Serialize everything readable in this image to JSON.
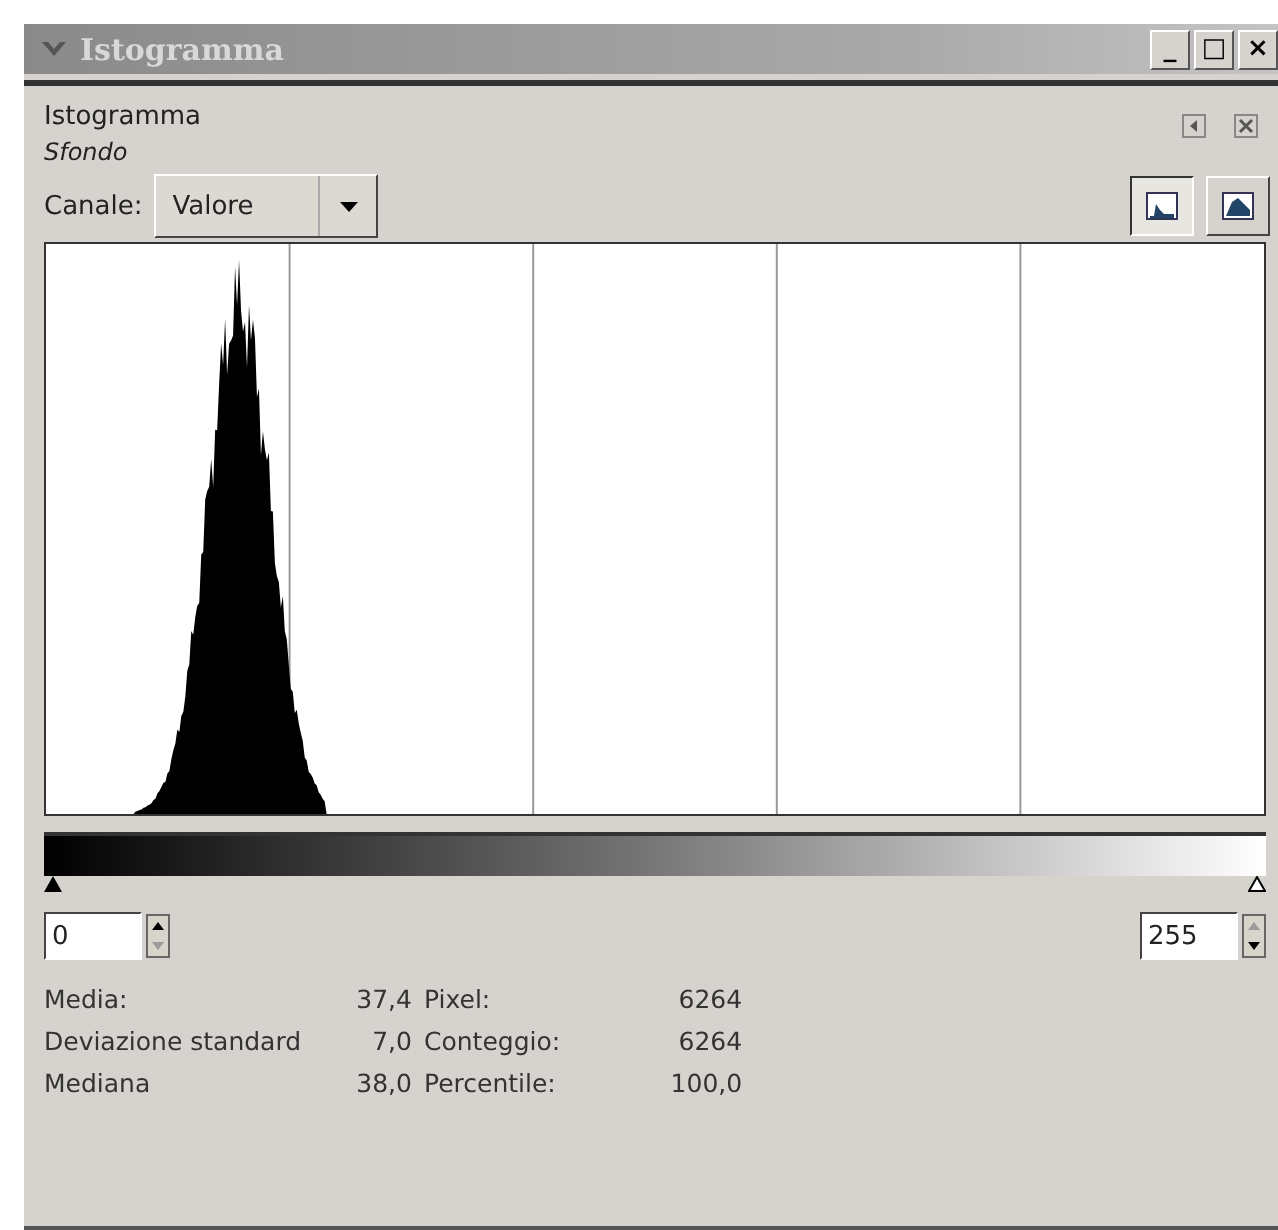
{
  "window": {
    "title": "Istogramma",
    "controls": [
      "_",
      "□",
      "×"
    ]
  },
  "panel": {
    "title": "Istogramma",
    "subtitle": "Sfondo"
  },
  "channel": {
    "label": "Canale:",
    "value": "Valore"
  },
  "scale_buttons": [
    {
      "kind": "linear",
      "selected": true
    },
    {
      "kind": "log",
      "selected": false
    }
  ],
  "range": {
    "min": "0",
    "max": "255"
  },
  "stats": [
    {
      "label": "Media:",
      "value": "37,4",
      "label2": "Pixel:",
      "value2": "6264"
    },
    {
      "label": "Deviazione standard",
      "value": "7,0",
      "label2": "Conteggio:",
      "value2": "6264"
    },
    {
      "label": "Mediana",
      "value": "38,0",
      "label2": "Percentile:",
      "value2": "100,0"
    }
  ]
}
